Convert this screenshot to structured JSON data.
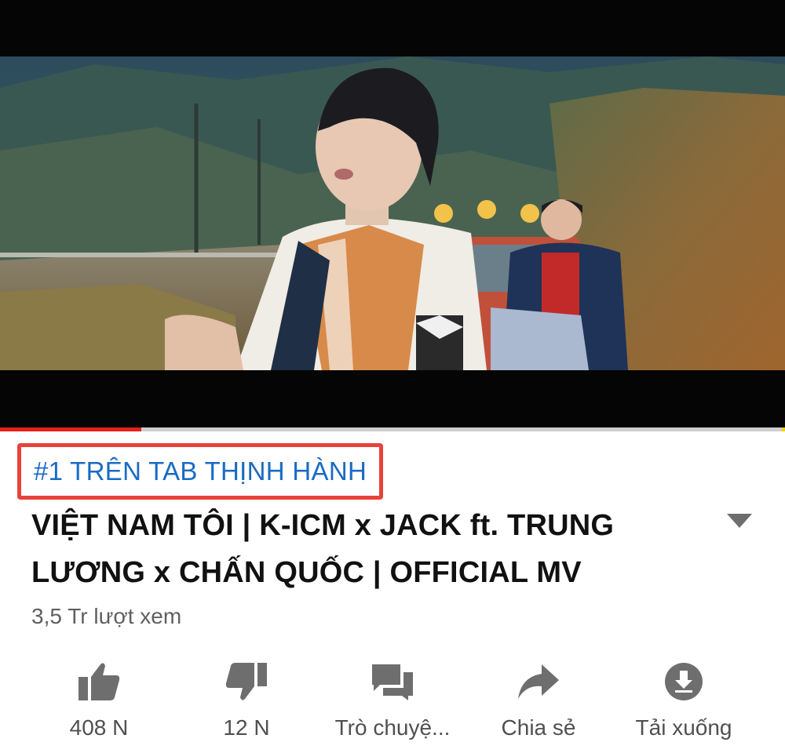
{
  "video": {
    "progress": 0.18
  },
  "badge": {
    "text": "#1 TRÊN TAB THỊNH HÀNH"
  },
  "title": {
    "line1": "VIỆT NAM TÔI | K-ICM x JACK ft. TRUNG",
    "line2": "LƯƠNG x CHẤN QUỐC | OFFICIAL MV"
  },
  "views": "3,5 Tr lượt xem",
  "actions": [
    {
      "label": "408 N",
      "icon": "thumbs-up-icon"
    },
    {
      "label": "12 N",
      "icon": "thumbs-down-icon"
    },
    {
      "label": "Trò chuyệ...",
      "icon": "chat-icon"
    },
    {
      "label": "Chia sẻ",
      "icon": "share-icon"
    },
    {
      "label": "Tải xuống",
      "icon": "download-icon"
    }
  ],
  "colors": {
    "badge_border": "#e8423c",
    "badge_text": "#1a6bc4",
    "progress": "#e62117",
    "icon": "#6e6e6e"
  }
}
